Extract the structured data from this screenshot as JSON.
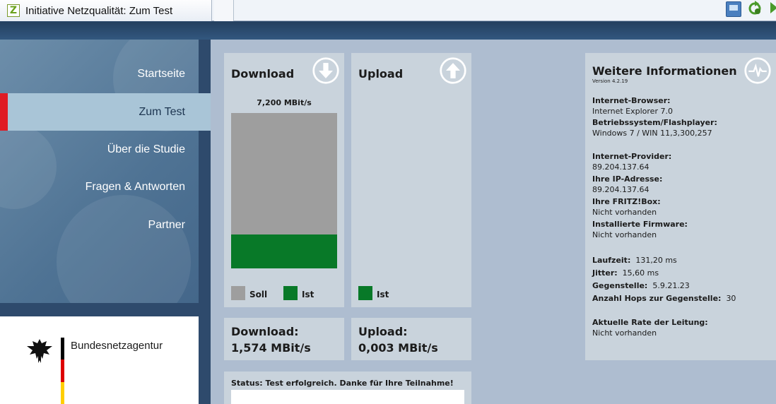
{
  "browser": {
    "tab_title": "Initiative Netzqualität: Zum Test",
    "favicon_letter": "Z"
  },
  "nav": {
    "items": [
      {
        "label": "Startseite"
      },
      {
        "label": "Zum Test"
      },
      {
        "label": "Über die Studie"
      },
      {
        "label": "Fragen & Antworten"
      },
      {
        "label": "Partner"
      }
    ],
    "active_index": 1
  },
  "logo": {
    "text": "Bundesnetzagentur",
    "flag_colors": [
      "#000000",
      "#dd0000",
      "#ffce00"
    ]
  },
  "download_panel": {
    "title": "Download",
    "icon": "arrow-down-circle-icon",
    "max_label": "7,200 MBit/s",
    "fill_fraction": 0.22,
    "legend_soll": "Soll",
    "legend_ist": "Ist",
    "soll_color": "#9e9e9e",
    "ist_color": "#087928"
  },
  "upload_panel": {
    "title": "Upload",
    "icon": "arrow-up-circle-icon",
    "legend_ist": "Ist"
  },
  "results": {
    "download_label": "Download:",
    "download_value": "1,574 MBit/s",
    "upload_label": "Upload:",
    "upload_value": "0,003 MBit/s"
  },
  "status": {
    "text": "Status: Test erfolgreich. Danke für Ihre Teilnahme!"
  },
  "info": {
    "title": "Weitere Informationen",
    "version": "Version 4.2.19",
    "icon": "pulse-circle-icon",
    "browser_label": "Internet-Browser:",
    "browser_value": "Internet Explorer 7.0",
    "os_label": "Betriebssystem/Flashplayer:",
    "os_value": "Windows 7 / WIN 11,3,300,257",
    "provider_label": "Internet-Provider:",
    "provider_value": "89.204.137.64",
    "ip_label": "Ihre IP-Adresse:",
    "ip_value": "89.204.137.64",
    "fritz_label": "Ihre FRITZ!Box:",
    "fritz_value": "Nicht vorhanden",
    "firmware_label": "Installierte Firmware:",
    "firmware_value": "Nicht vorhanden",
    "laufzeit_label": "Laufzeit:",
    "laufzeit_value": "131,20 ms",
    "jitter_label": "Jitter:",
    "jitter_value": "15,60 ms",
    "gegenstelle_label": "Gegenstelle:",
    "gegenstelle_value": "5.9.21.23",
    "hops_label": "Anzahl Hops zur Gegenstelle:",
    "hops_value": "30",
    "rate_label": "Aktuelle Rate der Leitung:",
    "rate_value": "Nicht vorhanden"
  }
}
